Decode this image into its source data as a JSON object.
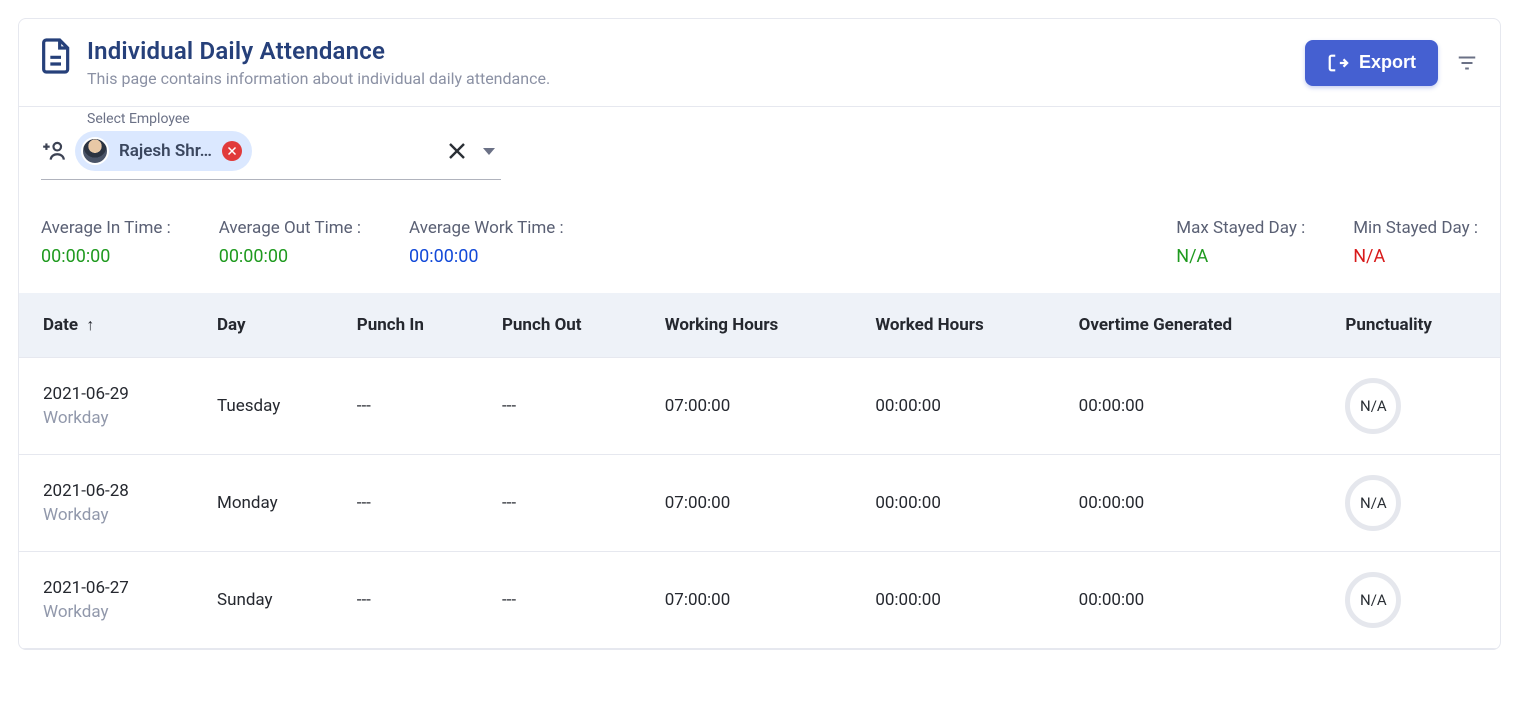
{
  "header": {
    "title": "Individual Daily Attendance",
    "subtitle": "This page contains information about individual daily attendance.",
    "export_label": "Export"
  },
  "selector": {
    "label": "Select Employee",
    "chip_text": "Rajesh Shr…"
  },
  "stats": {
    "avg_in": {
      "label": "Average In Time :",
      "value": "00:00:00"
    },
    "avg_out": {
      "label": "Average Out Time :",
      "value": "00:00:00"
    },
    "avg_work": {
      "label": "Average Work Time :",
      "value": "00:00:00"
    },
    "max_stayed": {
      "label": "Max Stayed Day :",
      "value": "N/A"
    },
    "min_stayed": {
      "label": "Min Stayed Day :",
      "value": "N/A"
    }
  },
  "columns": {
    "date": "Date",
    "day": "Day",
    "punch_in": "Punch In",
    "punch_out": "Punch Out",
    "working_hours": "Working Hours",
    "worked_hours": "Worked Hours",
    "overtime": "Overtime Generated",
    "punctuality": "Punctuality"
  },
  "rows": [
    {
      "date": "2021-06-29",
      "sub": "Workday",
      "day": "Tuesday",
      "punch_in": "---",
      "punch_out": "---",
      "working": "07:00:00",
      "worked": "00:00:00",
      "overtime": "00:00:00",
      "punctuality": "N/A"
    },
    {
      "date": "2021-06-28",
      "sub": "Workday",
      "day": "Monday",
      "punch_in": "---",
      "punch_out": "---",
      "working": "07:00:00",
      "worked": "00:00:00",
      "overtime": "00:00:00",
      "punctuality": "N/A"
    },
    {
      "date": "2021-06-27",
      "sub": "Workday",
      "day": "Sunday",
      "punch_in": "---",
      "punch_out": "---",
      "working": "07:00:00",
      "worked": "00:00:00",
      "overtime": "00:00:00",
      "punctuality": "N/A"
    }
  ]
}
